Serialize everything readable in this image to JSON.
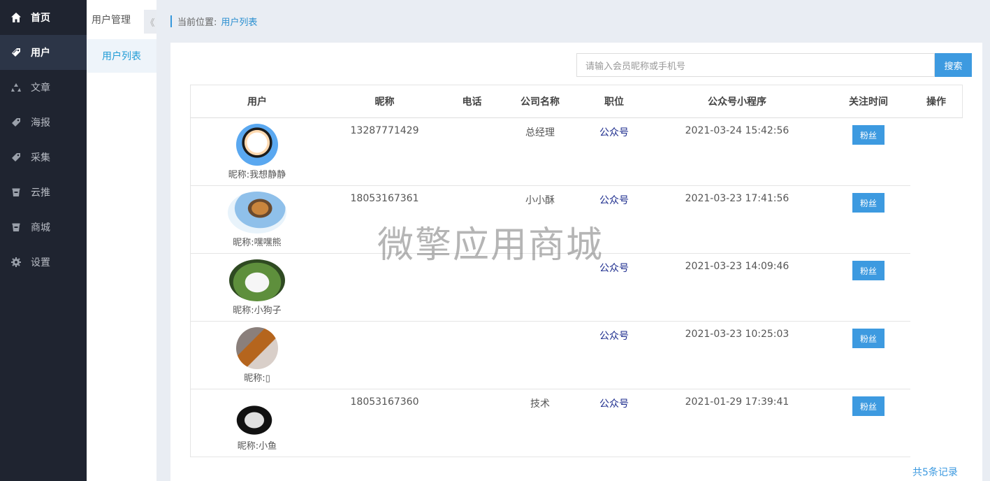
{
  "sidebar": {
    "items": [
      {
        "label": "首页",
        "icon": "home-icon"
      },
      {
        "label": "用户",
        "icon": "tag-icon"
      },
      {
        "label": "文章",
        "icon": "recycle-icon"
      },
      {
        "label": "海报",
        "icon": "tag-icon"
      },
      {
        "label": "采集",
        "icon": "tag-icon"
      },
      {
        "label": "云推",
        "icon": "bucket-icon"
      },
      {
        "label": "商城",
        "icon": "bucket-icon"
      },
      {
        "label": "设置",
        "icon": "gear-icon"
      }
    ]
  },
  "subnav": {
    "title": "用户管理",
    "collapse_glyph": "《",
    "item": "用户列表"
  },
  "breadcrumb": {
    "prefix": "当前位置:",
    "current": "用户列表"
  },
  "search": {
    "placeholder": "请输入会员昵称或手机号",
    "button": "搜索"
  },
  "table": {
    "headers": [
      "用户",
      "昵称",
      "电话",
      "公司名称",
      "职位",
      "公众号小程序",
      "关注时间",
      "操作"
    ],
    "rows": [
      {
        "nick": "昵称:我想静静",
        "phone": "13287771429",
        "company": "总经理",
        "platform": "公众号",
        "time": "2021-03-24 15:42:56",
        "action": "粉丝"
      },
      {
        "nick": "昵称:嘿嘿熊",
        "phone": "18053167361",
        "company": "小小酥",
        "platform": "公众号",
        "time": "2021-03-23 17:41:56",
        "action": "粉丝"
      },
      {
        "nick": "昵称:小狗子",
        "phone": "",
        "company": "",
        "platform": "公众号",
        "time": "2021-03-23 14:09:46",
        "action": "粉丝"
      },
      {
        "nick": "昵称:▯",
        "phone": "",
        "company": "",
        "platform": "公众号",
        "time": "2021-03-23 10:25:03",
        "action": "粉丝"
      },
      {
        "nick": "昵称:小鱼",
        "phone": "18053167360",
        "company": "技术",
        "platform": "公众号",
        "time": "2021-01-29 17:39:41",
        "action": "粉丝"
      }
    ]
  },
  "footer": {
    "total": "共5条记录"
  },
  "watermark": "微擎应用商城",
  "colors": {
    "sidebar_bg": "#1f2430",
    "accent": "#3d9ae0",
    "link": "#1f9bd6"
  }
}
